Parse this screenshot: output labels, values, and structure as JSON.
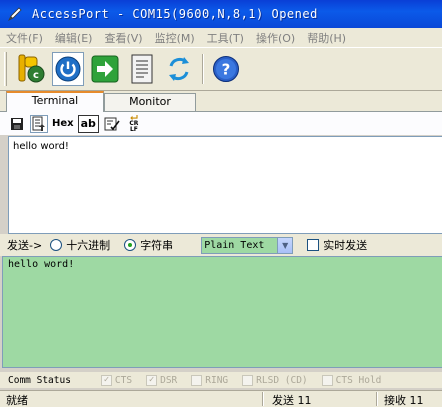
{
  "window": {
    "title": "AccessPort - COM15(9600,N,8,1) Opened"
  },
  "menu": [
    "文件(F)",
    "编辑(E)",
    "查看(V)",
    "监控(M)",
    "工具(T)",
    "操作(O)",
    "帮助(H)"
  ],
  "toolbar_icons": [
    "connect-port-icon",
    "power-icon",
    "forward-arrow-icon",
    "document-icon",
    "refresh-icon",
    "help-icon"
  ],
  "tabs": [
    {
      "label": "Terminal",
      "active": true
    },
    {
      "label": "Monitor",
      "active": false
    }
  ],
  "subtoolbar": {
    "hex": "Hex",
    "ab": "ab",
    "crlf_top": "CR",
    "crlf_bottom": "LF"
  },
  "receive": {
    "text": "hello word!"
  },
  "send": {
    "label": "发送->",
    "option_hex": "十六进制",
    "option_string": "字符串",
    "selected": "字符串",
    "format": "Plain Text",
    "realtime_label": "实时发送",
    "realtime_checked": false,
    "text": "hello word!"
  },
  "comm": {
    "label": "Comm Status",
    "signals": [
      {
        "label": "CTS",
        "checked": true
      },
      {
        "label": "DSR",
        "checked": true
      },
      {
        "label": "RING",
        "checked": false
      },
      {
        "label": "RLSD (CD)",
        "checked": false
      },
      {
        "label": "CTS Hold",
        "checked": false
      }
    ]
  },
  "status": {
    "state": "就绪",
    "sent": "发送 11",
    "received": "接收 11"
  },
  "colors": {
    "title_bar": "#0b5ae9",
    "send_bg": "#9ed9a3",
    "tab_accent": "#e68b2c"
  }
}
